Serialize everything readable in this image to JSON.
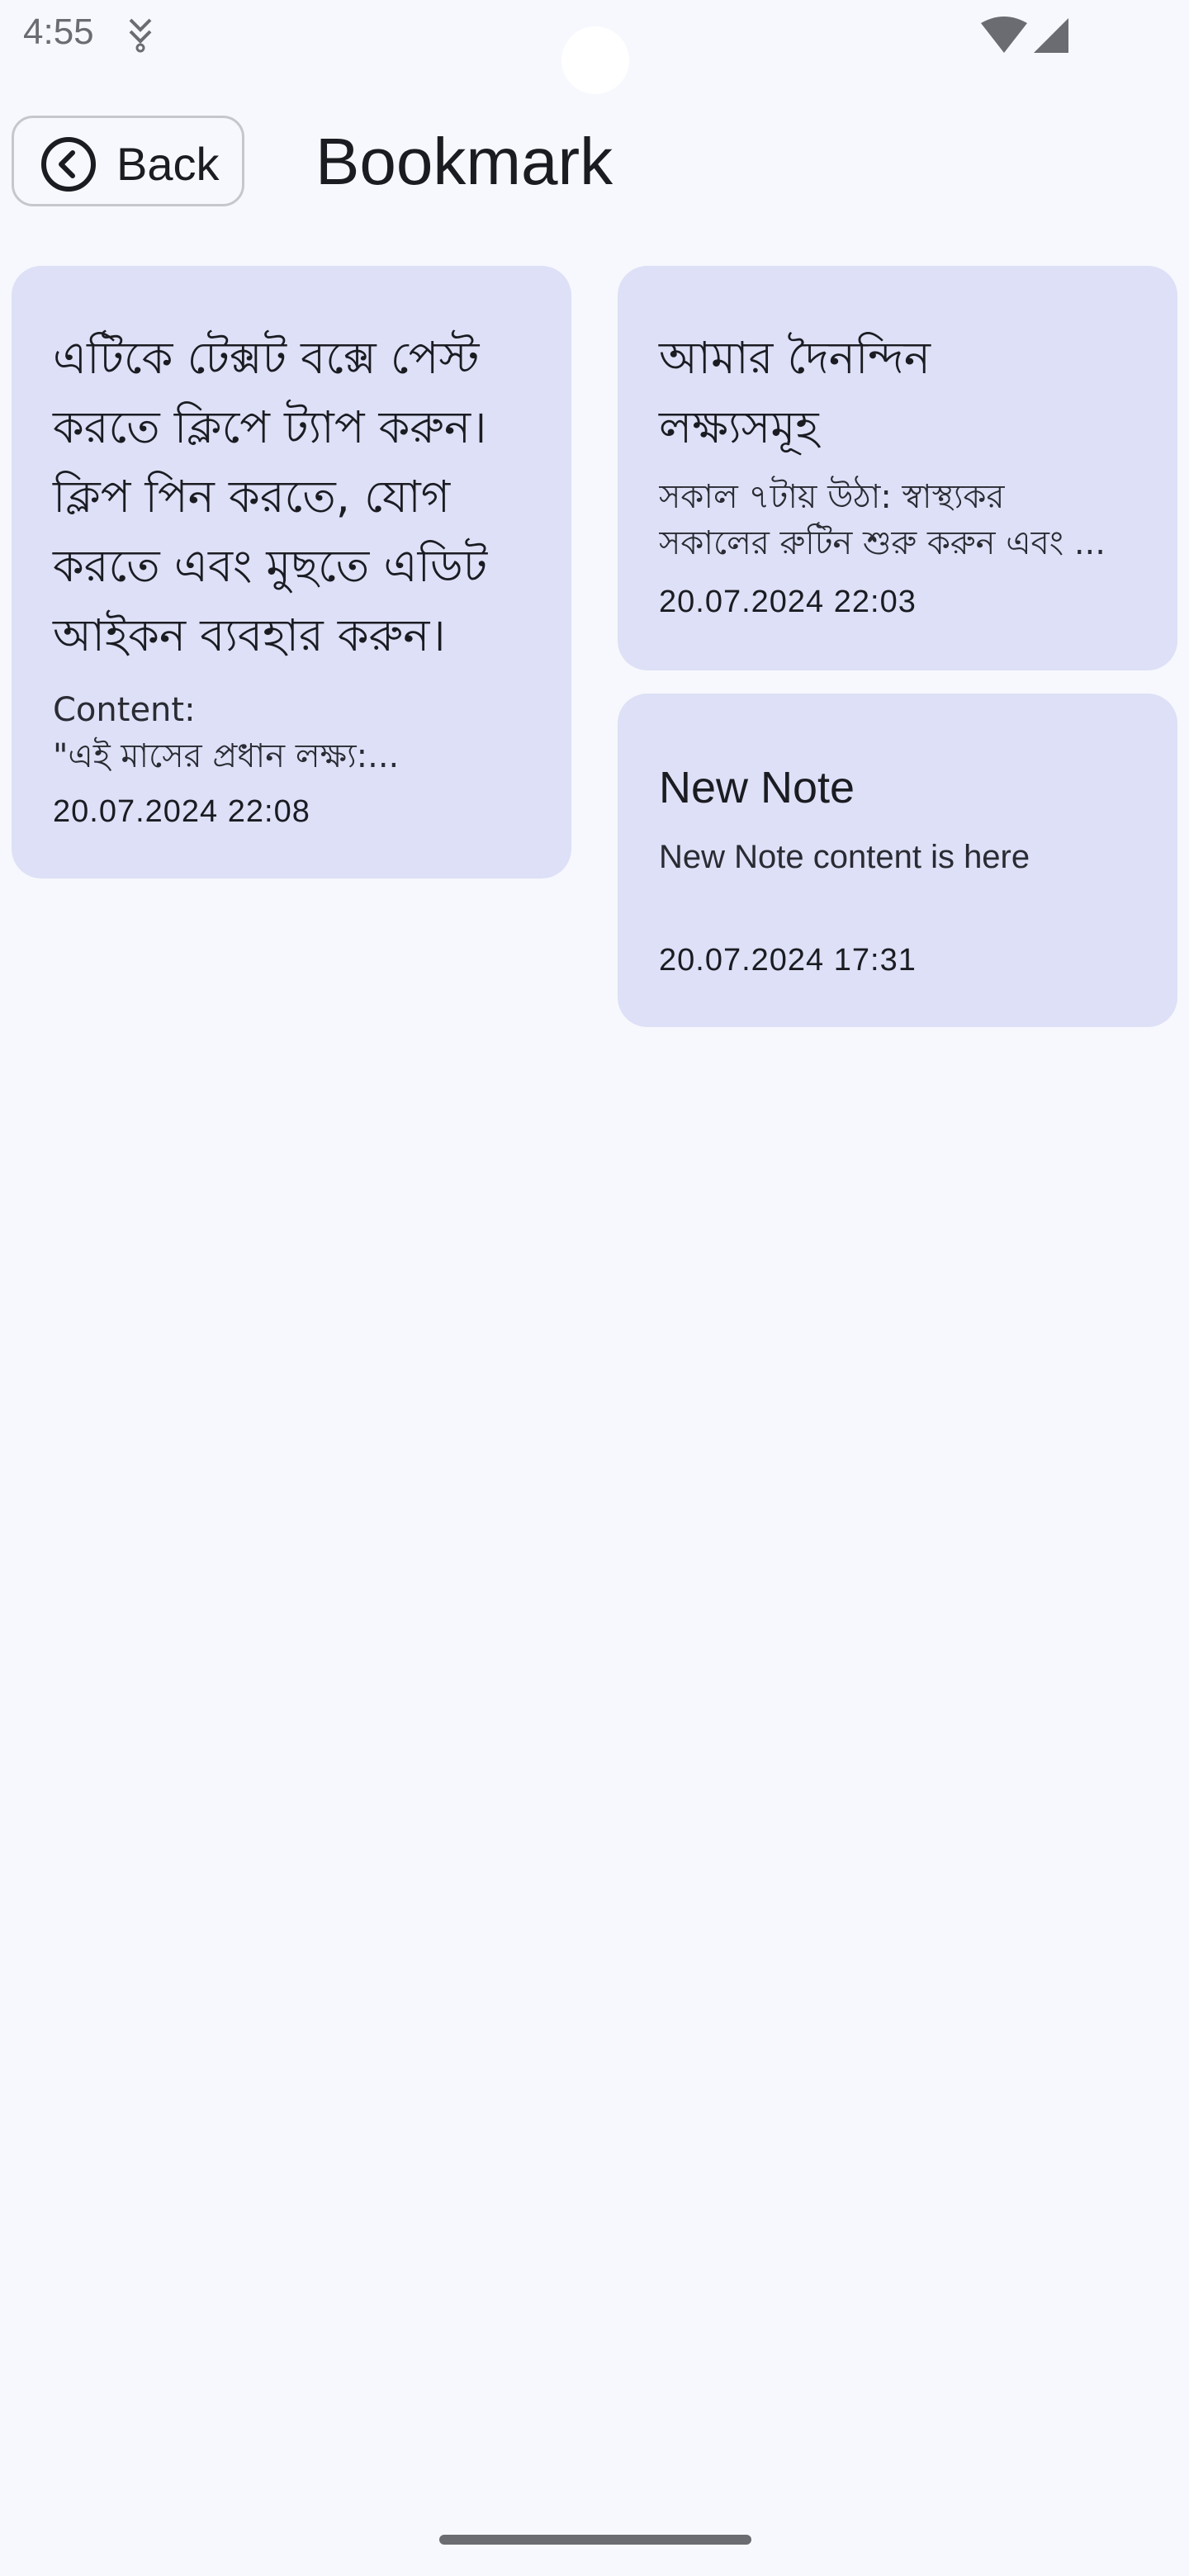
{
  "status_bar": {
    "time": "4:55",
    "notification_icon": "download-notification-icon",
    "wifi_icon": "wifi-icon",
    "signal_icon": "signal-icon"
  },
  "header": {
    "back_label": "Back",
    "back_icon": "chevron-left-circle-icon",
    "title": "Bookmark"
  },
  "notes": [
    {
      "title_lines": [
        "এটিকে টেক্সট বক্সে পেস্ট",
        "করতে ক্লিপে ট্যাপ করুন।",
        "ক্লিপ পিন করতে, যোগ",
        "করতে এবং মুছতে এডিট",
        "আইকন ব্যবহার করুন।"
      ],
      "body_lines": [
        "Content:",
        "\"এই মাসের প্রধান লক্ষ্য:..."
      ],
      "date": "20.07.2024 22:08"
    },
    {
      "title_lines": [
        "আমার দৈনন্দিন",
        "লক্ষ্যসমূহ"
      ],
      "body_lines": [
        "সকাল ৭টায় উঠা: স্বাস্থ্যকর",
        "সকালের রুটিন শুরু করুন এবং ..."
      ],
      "date": "20.07.2024 22:03"
    },
    {
      "title_lines": [
        "New Note"
      ],
      "body_lines": [
        "New Note content is here"
      ],
      "date": "20.07.2024 17:31"
    }
  ],
  "colors": {
    "background": "#f7f8fd",
    "card": "#dde0f6",
    "text": "#1b1c22"
  }
}
